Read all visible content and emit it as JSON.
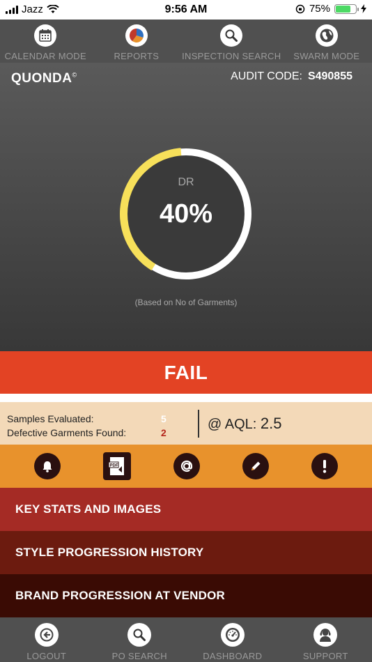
{
  "status_bar": {
    "carrier": "Jazz",
    "time": "9:56 AM",
    "battery": "75%",
    "battery_level": 0.75
  },
  "top_nav": {
    "items": [
      {
        "label": "CALENDAR MODE",
        "icon": "calendar-icon"
      },
      {
        "label": "REPORTS",
        "icon": "pie-chart-icon"
      },
      {
        "label": "INSPECTION SEARCH",
        "icon": "magnifier-icon"
      },
      {
        "label": "SWARM MODE",
        "icon": "globe-icon"
      }
    ]
  },
  "header": {
    "brand": "QUONDA",
    "brand_mark": "©",
    "audit_label": "AUDIT CODE:",
    "audit_code": "S490855"
  },
  "donut": {
    "label": "DR",
    "value": "40%",
    "fraction": 0.4,
    "note": "(Based on No of Garments)",
    "colors": {
      "filled": "#f7e05a",
      "remaining": "#ffffff",
      "track": "#3a3a3a"
    }
  },
  "result": {
    "text": "FAIL",
    "color": "#e34324"
  },
  "stats": {
    "samples_label": "Samples Evaluated:",
    "samples_value": "5",
    "defective_label": "Defective Garments Found:",
    "defective_value": "2",
    "aql_prefix": "@ AQL:",
    "aql_value": "2.5"
  },
  "actions": [
    {
      "icon": "bell-icon"
    },
    {
      "icon": "pdf-icon"
    },
    {
      "icon": "at-icon"
    },
    {
      "icon": "pencil-icon"
    },
    {
      "icon": "alert-icon"
    }
  ],
  "sections": [
    {
      "label": "KEY STATS AND IMAGES"
    },
    {
      "label": "STYLE PROGRESSION HISTORY"
    },
    {
      "label": "BRAND PROGRESSION AT VENDOR"
    }
  ],
  "bottom_nav": {
    "items": [
      {
        "label": "LOGOUT",
        "icon": "logout-icon"
      },
      {
        "label": "PO SEARCH",
        "icon": "search-icon"
      },
      {
        "label": "DASHBOARD",
        "icon": "speedometer-icon"
      },
      {
        "label": "SUPPORT",
        "icon": "headset-icon"
      }
    ]
  }
}
